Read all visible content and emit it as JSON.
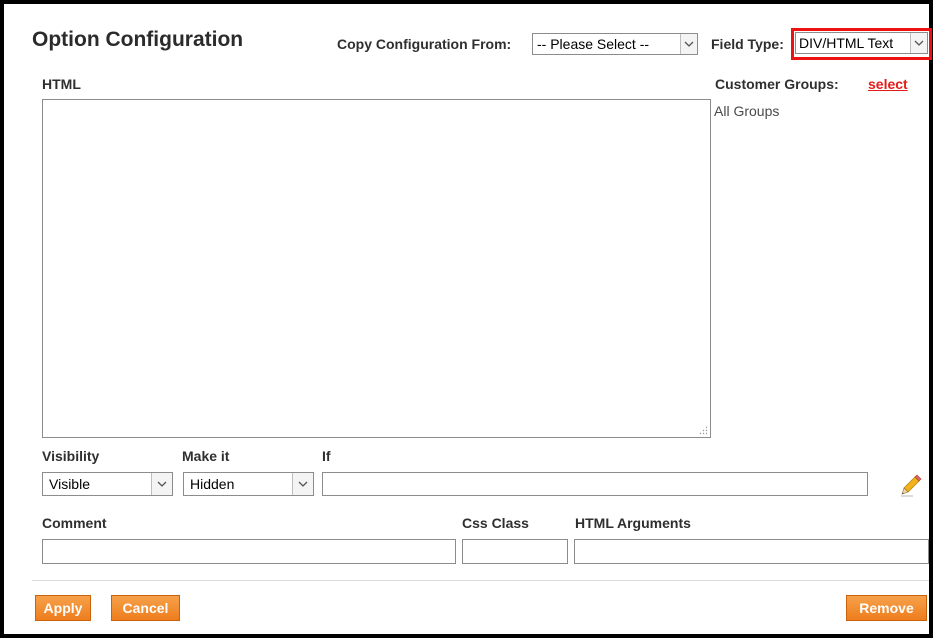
{
  "panel": {
    "title": "Option Configuration",
    "copy_from_label": "Copy Configuration From:",
    "copy_from_value": "-- Please Select --",
    "field_type_label": "Field Type:",
    "field_type_value": "DIV/HTML Text",
    "html_label": "HTML",
    "html_value": "",
    "customer_groups_label": "Customer Groups:",
    "customer_groups_link": "select",
    "customer_groups_value": "All Groups"
  },
  "visibility": {
    "visibility_label": "Visibility",
    "visibility_value": "Visible",
    "make_it_label": "Make it",
    "make_it_value": "Hidden",
    "if_label": "If",
    "if_value": ""
  },
  "meta": {
    "comment_label": "Comment",
    "comment_value": "",
    "css_class_label": "Css Class",
    "css_class_value": "",
    "html_arguments_label": "HTML Arguments",
    "html_arguments_value": ""
  },
  "buttons": {
    "apply": "Apply",
    "cancel": "Cancel",
    "remove": "Remove"
  },
  "icons": {
    "dropdown": "chevron-down-icon",
    "edit": "pencil-icon",
    "resize": "resize-grip-icon"
  },
  "colors": {
    "button_orange": "#ef8a2e",
    "highlight_red": "#ee1111",
    "link_red": "#e41b17"
  }
}
